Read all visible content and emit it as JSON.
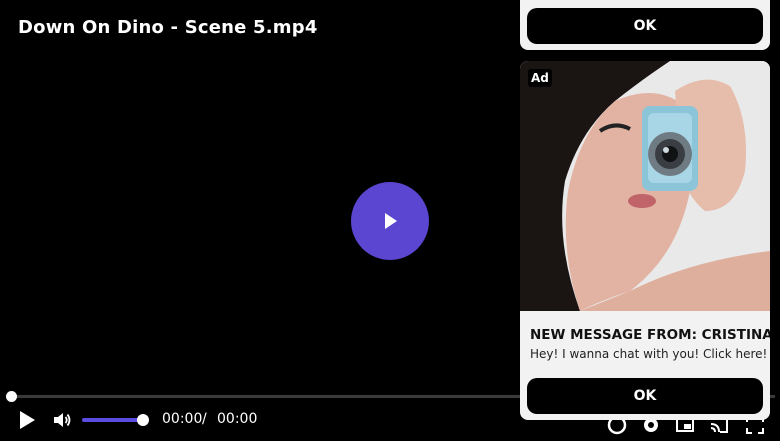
{
  "player": {
    "title": "Down On Dino - Scene 5.mp4",
    "current_time": "00:00",
    "separator": "/",
    "duration": "00:00",
    "progress_fraction": 0.0,
    "volume_fraction": 1.0,
    "accent_color": "#5a46d0"
  },
  "ad_top": {
    "ok_label": "OK"
  },
  "ad": {
    "badge": "Ad",
    "title": "NEW MESSAGE FROM: CRISTINA",
    "text": "Hey! I wanna chat with you! Click here!",
    "ok_label": "OK"
  },
  "icons": {
    "big_play": "play-icon",
    "play": "play-icon",
    "volume": "volume-icon",
    "captions": "captions-icon",
    "settings": "gear-icon",
    "pip": "picture-in-picture-icon",
    "cast": "cast-icon",
    "fullscreen": "fullscreen-icon"
  }
}
